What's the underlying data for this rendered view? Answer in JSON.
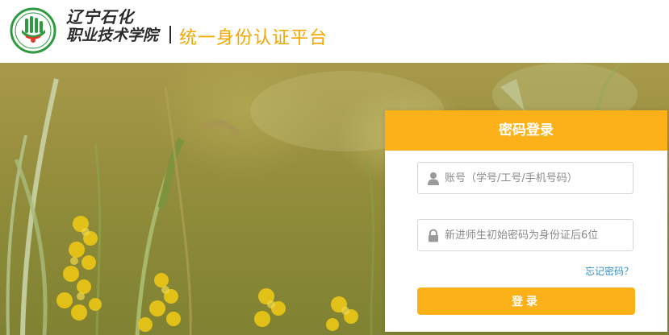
{
  "header": {
    "school_name_line1": "辽宁石化",
    "school_name_line2": "职业技术学院",
    "platform_name": "统一身份认证平台",
    "logo_icon": "school-emblem-icon"
  },
  "login": {
    "title": "密码登录",
    "username_placeholder": "账号（学号/工号/手机号码）",
    "password_placeholder": "新进师生初始密码为身份证后6位",
    "forgot_label": "忘记密码？",
    "submit_label": "登录",
    "user_icon": "user-icon",
    "lock_icon": "lock-icon"
  },
  "colors": {
    "accent": "#fdb118",
    "platform_text": "#f5a700",
    "link": "#2f8fc9",
    "logo_green": "#2e9a3f"
  }
}
